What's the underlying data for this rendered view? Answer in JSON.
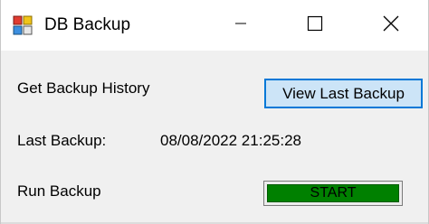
{
  "window": {
    "title": "DB Backup",
    "icon": "db-backup-app-icon",
    "controls": {
      "minimize_icon": "minimize-icon",
      "maximize_icon": "maximize-icon",
      "close_icon": "close-icon"
    }
  },
  "main": {
    "history_label": "Get Backup History",
    "view_last_backup_button": "View Last Backup",
    "last_backup_label": "Last Backup:",
    "last_backup_value": "08/08/2022 21:25:28",
    "run_backup_label": "Run Backup",
    "start_button": "START"
  },
  "colors": {
    "window_bg": "#f0f0f0",
    "titlebar_bg": "#ffffff",
    "focused_button_bg": "#cce4f7",
    "focused_button_border": "#0078d7",
    "start_button_fill": "#008000"
  }
}
